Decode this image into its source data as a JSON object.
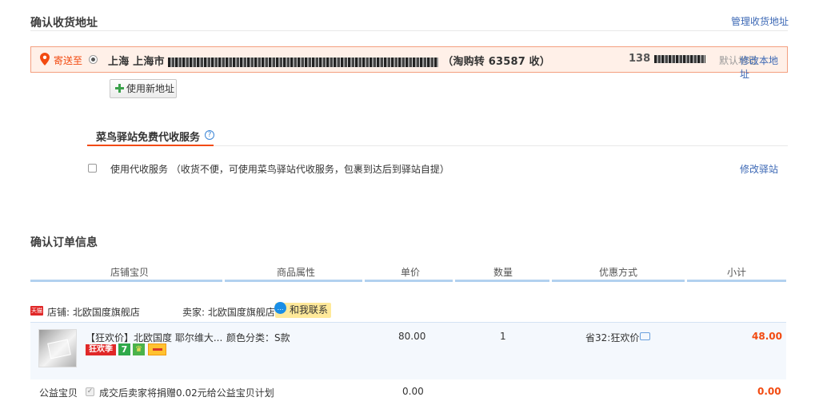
{
  "address": {
    "section_title": "确认收货地址",
    "manage_link": "管理收货地址",
    "send_to_label": "寄送至",
    "address_prefix": "上海 上海市",
    "address_suffix": "（淘购转 63587 收）",
    "phone": "138",
    "default_label": "默认地址",
    "modify_link": "修改本地址",
    "new_address_button": "使用新地址"
  },
  "cainiao": {
    "title": "菜鸟驿站免费代收服务",
    "help_icon_text": "?",
    "service_label": "使用代收服务 （收货不便，可使用菜鸟驿站代收服务，包裹到达后到驿站自提）",
    "modify_station_link": "修改驿站"
  },
  "order": {
    "section_title": "确认订单信息",
    "columns": [
      "店铺宝贝",
      "商品属性",
      "单价",
      "数量",
      "优惠方式",
      "小计"
    ],
    "shop_label": "店铺: 北欧国度旗舰店",
    "seller_label": "卖家: 北欧国度旗舰店",
    "contact_label": "和我联系",
    "tmall_badge": "天猫",
    "item": {
      "title": "【狂欢价】北欧国度 耶尔维大...",
      "attribute": "颜色分类：S款",
      "unit_price": "80.00",
      "quantity": "1",
      "discount": "省32:狂欢价",
      "subtotal": "48.00",
      "badge_kuanghuan": "狂欢季",
      "badge_7": "7"
    },
    "charity": {
      "label": "公益宝贝",
      "text": "成交后卖家将捐赠0.02元给公益宝贝计划",
      "price": "0.00",
      "subtotal": "0.00"
    }
  },
  "colors": {
    "accent": "#f24a10",
    "link": "#3c68b5",
    "address_bg": "#fff0e8",
    "table_bar": "#b2d1ef"
  }
}
